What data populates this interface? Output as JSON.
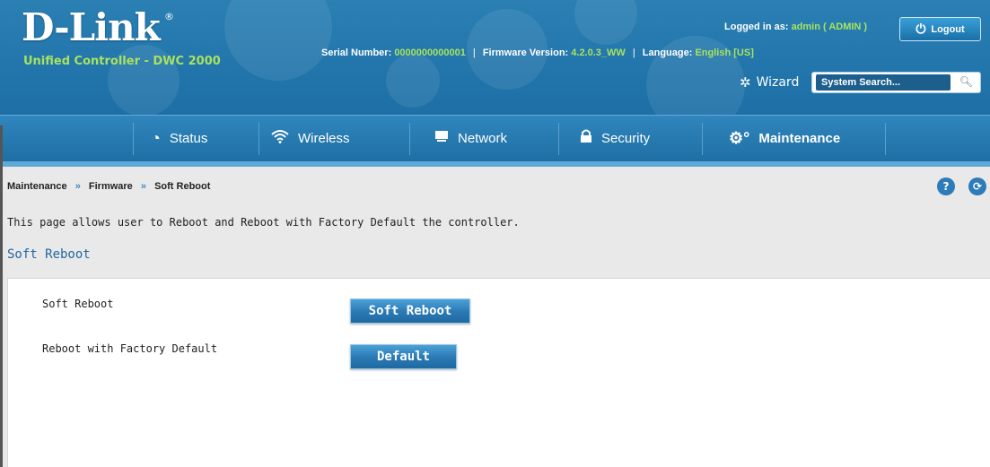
{
  "brand": {
    "logo": "D-Link",
    "logo_mark": "®",
    "subtitle": "Unified Controller - DWC 2000"
  },
  "header": {
    "logged_in_label": "Logged in as:",
    "logged_in_value": "admin ( ADMIN )",
    "logout_label": "Logout",
    "serial_label": "Serial Number:",
    "serial_value": "0000000000001",
    "firmware_label": "Firmware Version:",
    "firmware_value": "4.2.0.3_WW",
    "language_label": "Language:",
    "language_value": "English [US]",
    "wizard_label": "Wizard",
    "search_placeholder": "System Search..."
  },
  "nav": {
    "items": [
      {
        "label": "Status",
        "icon": "gauge-icon"
      },
      {
        "label": "Wireless",
        "icon": "wifi-icon"
      },
      {
        "label": "Network",
        "icon": "monitor-icon"
      },
      {
        "label": "Security",
        "icon": "lock-icon"
      },
      {
        "label": "Maintenance",
        "icon": "gears-icon",
        "active": true
      }
    ]
  },
  "breadcrumb": {
    "items": [
      "Maintenance",
      "Firmware",
      "Soft Reboot"
    ],
    "separator": "»"
  },
  "page": {
    "description": "This page allows user to Reboot and Reboot with Factory Default the controller.",
    "section_title": "Soft Reboot",
    "rows": [
      {
        "label": "Soft Reboot",
        "button": "Soft Reboot"
      },
      {
        "label": "Reboot with Factory Default",
        "button": "Default"
      }
    ]
  },
  "colors": {
    "header_blue": "#2478ad",
    "accent_green": "#a9e25f",
    "title_blue": "#2367a0"
  }
}
